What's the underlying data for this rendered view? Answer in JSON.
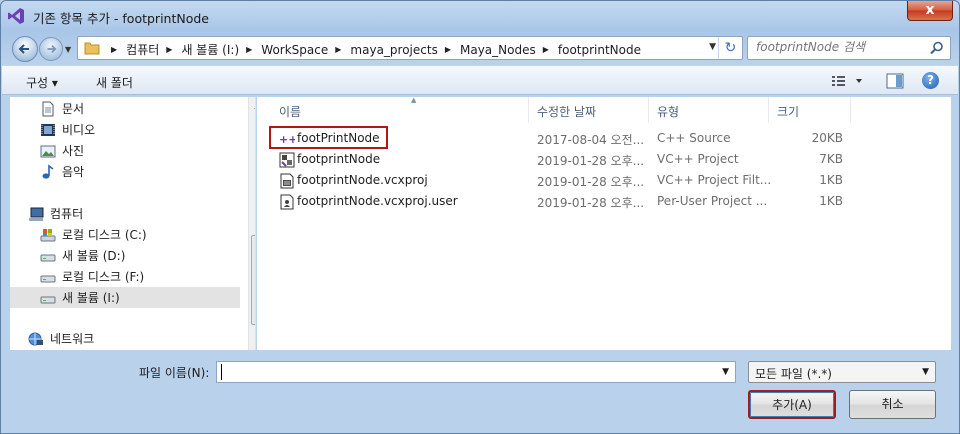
{
  "window": {
    "title": "기존 항목 추가 - footprintNode",
    "close_label": "x"
  },
  "address": {
    "crumbs": [
      "컴퓨터",
      "새 볼륨 (I:)",
      "WorkSpace",
      "maya_projects",
      "Maya_Nodes",
      "footprintNode"
    ]
  },
  "search": {
    "placeholder": "footprintNode 검색"
  },
  "toolbar": {
    "organize_label": "구성 ▾",
    "new_folder_label": "새 폴더",
    "help_label": "?"
  },
  "sidebar": {
    "items": [
      {
        "label": "문서",
        "icon": "document-icon"
      },
      {
        "label": "비디오",
        "icon": "video-icon"
      },
      {
        "label": "사진",
        "icon": "picture-icon"
      },
      {
        "label": "음악",
        "icon": "music-icon"
      },
      {
        "label": "컴퓨터",
        "icon": "computer-icon"
      },
      {
        "label": "로컬 디스크 (C:)",
        "icon": "system-drive-icon"
      },
      {
        "label": "새 볼륨 (D:)",
        "icon": "drive-icon"
      },
      {
        "label": "로컬 디스크 (F:)",
        "icon": "drive-icon"
      },
      {
        "label": "새 볼륨 (I:)",
        "icon": "drive-icon",
        "selected": true
      },
      {
        "label": "네트워크",
        "icon": "network-icon"
      }
    ]
  },
  "columns": {
    "name": "이름",
    "date": "수정한 날짜",
    "type": "유형",
    "size": "크기"
  },
  "files": [
    {
      "name": "footPrintNode",
      "date": "2017-08-04 오전...",
      "type": "C++ Source",
      "size": "20KB",
      "icon": "cpp-source-icon",
      "highlighted": true
    },
    {
      "name": "footprintNode",
      "date": "2019-01-28 오후...",
      "type": "VC++ Project",
      "size": "7KB",
      "icon": "vcxproj-icon"
    },
    {
      "name": "footprintNode.vcxproj",
      "date": "2019-01-28 오후...",
      "type": "VC++ Project Filt...",
      "size": "1KB",
      "icon": "filters-file-icon"
    },
    {
      "name": "footprintNode.vcxproj.user",
      "date": "2019-01-28 오후...",
      "type": "Per-User Project ...",
      "size": "1KB",
      "icon": "user-file-icon"
    }
  ],
  "bottom": {
    "filename_label": "파일 이름(N):",
    "filename_value": "",
    "filter_value": "모든 파일 (*.*)",
    "add_button": "추가(A)",
    "cancel_button": "취소"
  },
  "colors": {
    "highlight_box": "#b01818",
    "window_frame": "#b9d1ea",
    "selected_row": "#e3e3e3"
  }
}
